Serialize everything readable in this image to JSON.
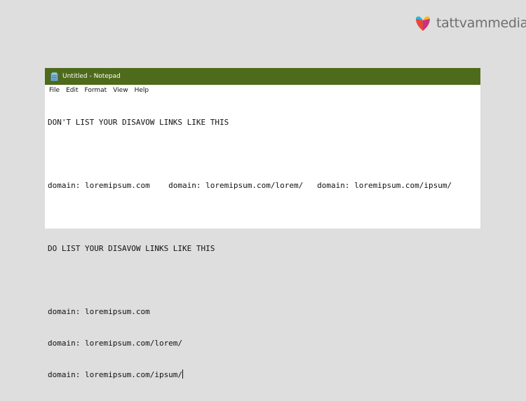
{
  "brand": {
    "logo_text": "tattvammedia",
    "logo_icon": "heart-bird-logo-icon"
  },
  "window": {
    "title": "Untitled - Notepad",
    "app_icon": "notepad-icon",
    "titlebar_color": "#4e6a1b"
  },
  "menu": {
    "items": [
      "File",
      "Edit",
      "Format",
      "View",
      "Help"
    ]
  },
  "editor": {
    "lines": [
      "DON'T LIST YOUR DISAVOW LINKS LIKE THIS",
      "",
      "domain: loremipsum.com    domain: loremipsum.com/lorem/   domain: loremipsum.com/ipsum/",
      "",
      "DO LIST YOUR DISAVOW LINKS LIKE THIS",
      "",
      "domain: loremipsum.com",
      "domain: loremipsum.com/lorem/",
      "domain: loremipsum.com/ipsum/"
    ]
  }
}
